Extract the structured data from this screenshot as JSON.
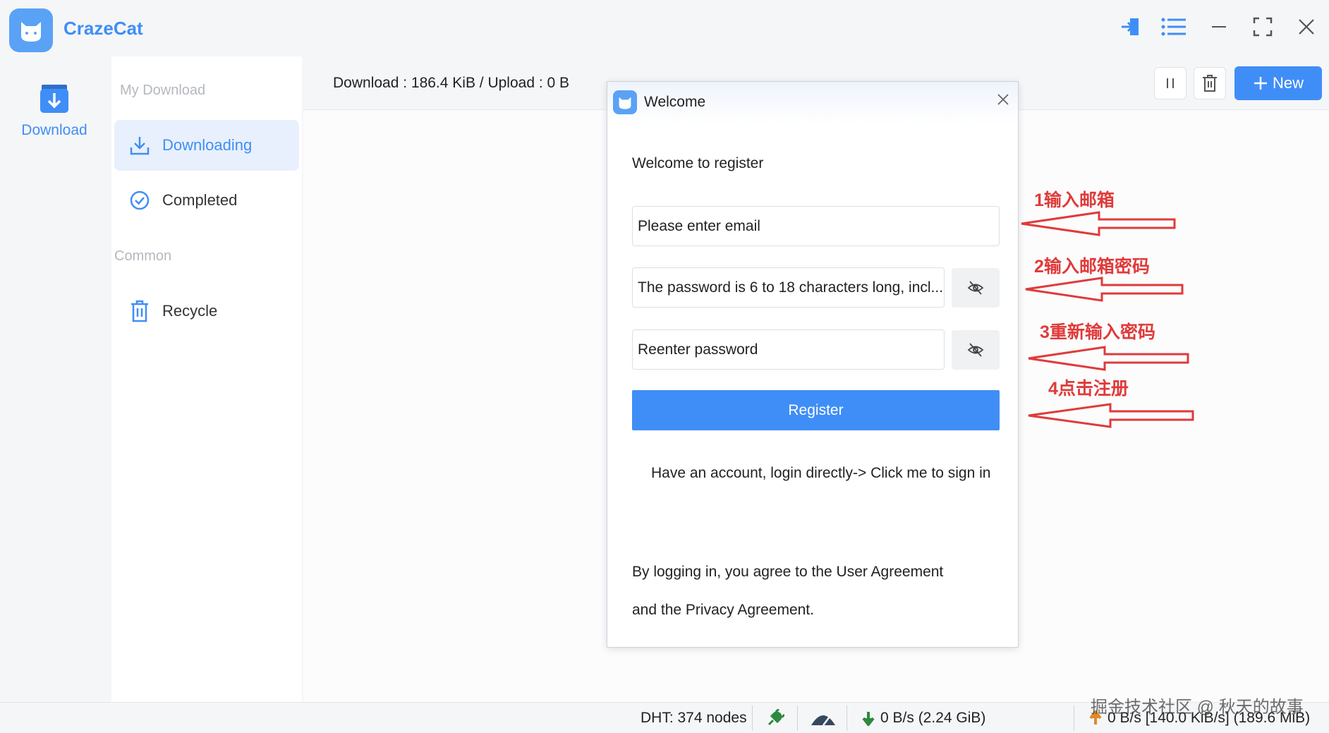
{
  "app": {
    "name": "CrazeCat"
  },
  "rail": {
    "download_label": "Download"
  },
  "sidebar": {
    "my_download_title": "My Download",
    "downloading": "Downloading",
    "completed": "Completed",
    "common_title": "Common",
    "recycle": "Recycle"
  },
  "header": {
    "stats": "Download : 186.4 KiB / Upload : 0 B",
    "new_label": "New"
  },
  "dialog": {
    "title": "Welcome",
    "subtitle": "Welcome to register",
    "email_placeholder": "Please enter email",
    "password_placeholder": "The password is 6 to 18 characters long, incl...",
    "reenter_placeholder": "Reenter password",
    "register_label": "Register",
    "signin_text": "Have an account, login directly-> Click me to sign in",
    "agree_line1": "By logging in, you agree to the User Agreement",
    "agree_line2": "and the Privacy Agreement."
  },
  "annotations": {
    "step1": "1输入邮箱",
    "step2": "2输入邮箱密码",
    "step3": "3重新输入密码",
    "step4": "4点击注册"
  },
  "statusbar": {
    "dht": "DHT: 374 nodes",
    "down_speed": "0 B/s (2.24 GiB)",
    "up_speed": "0 B/s [140.0 KiB/s] (189.6 MiB)"
  },
  "watermark": "掘金技术社区 @ 秋天的故事",
  "colors": {
    "accent": "#3f8ef7",
    "annotation": "#e03a3a"
  }
}
